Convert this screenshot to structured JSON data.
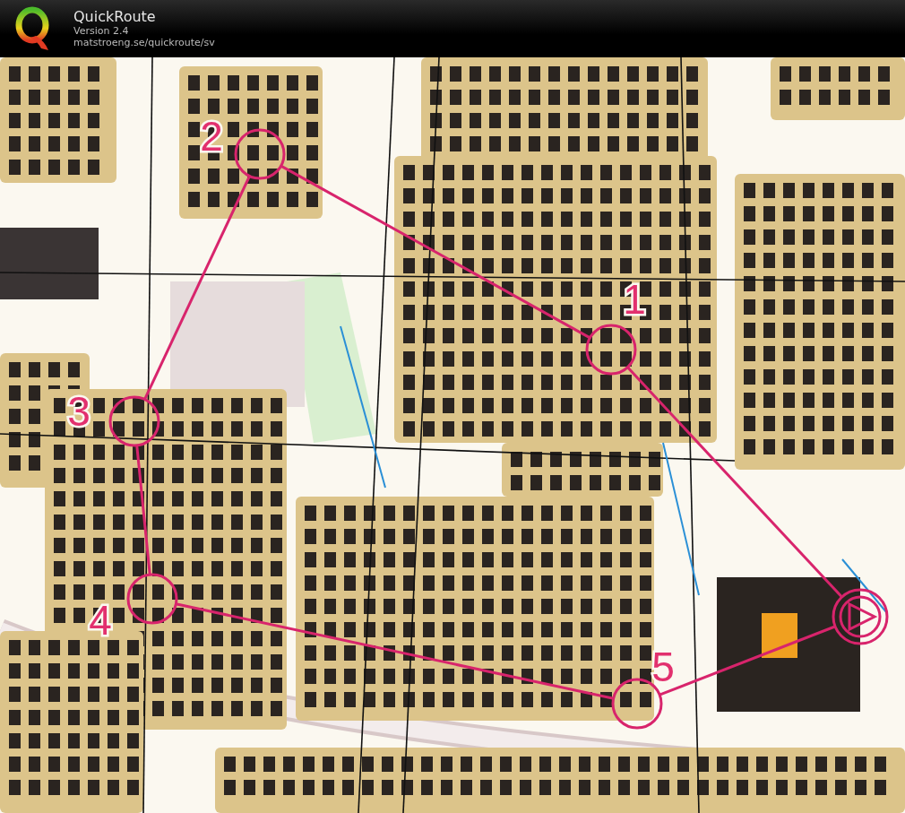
{
  "window": {
    "title": "QuickRoute",
    "version": "Version 2.4",
    "url": "matstroeng.se/quickroute/sv"
  },
  "course": {
    "controls": [
      {
        "kind": "start-finish"
      },
      {
        "kind": "control",
        "label": "1"
      },
      {
        "kind": "control",
        "label": "2"
      },
      {
        "kind": "control",
        "label": "3"
      },
      {
        "kind": "control",
        "label": "4"
      },
      {
        "kind": "control",
        "label": "5"
      }
    ]
  }
}
